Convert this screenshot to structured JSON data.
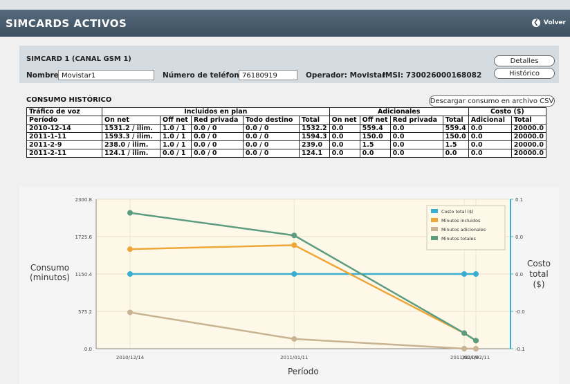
{
  "header": {
    "title": "SIMCARDS ACTIVOS",
    "back_label": "Volver"
  },
  "simcard": {
    "title": "SIMCARD 1 (CANAL GSM 1)",
    "nombre_label": "Nombre",
    "nombre_value": "Movistar1",
    "telefono_label": "Número de teléfono",
    "telefono_value": "76180919",
    "operador_label": "Operador:",
    "operador_value": "Movistar",
    "imsi_label": "IMSI:",
    "imsi_value": "730026000168082",
    "detalles_label": "Detalles",
    "historico_label": "Histórico"
  },
  "consumo": {
    "title": "CONSUMO HISTÓRICO",
    "csv_label": "Descargar consumo en archivo CSV",
    "group_headers": [
      "Tráfico de voz",
      "Incluidos en plan",
      "Adicionales",
      "Costo ($)"
    ],
    "columns": [
      "Período",
      "On net",
      "Off net",
      "Red privada",
      "Todo destino",
      "Total",
      "On net",
      "Off net",
      "Red privada",
      "Total",
      "Adicional",
      "Total"
    ],
    "rows": [
      [
        "2010-12-14",
        "1531.2 / ilim.",
        "1.0 / 1",
        "0.0 / 0",
        "0.0 / 0",
        "1532.2",
        "0.0",
        "559.4",
        "0.0",
        "559.4",
        "0.0",
        "20000.0"
      ],
      [
        "2011-1-11",
        "1593.3 / ilim.",
        "1.0 / 1",
        "0.0 / 0",
        "0.0 / 0",
        "1594.3",
        "0.0",
        "150.0",
        "0.0",
        "150.0",
        "0.0",
        "20000.0"
      ],
      [
        "2011-2-9",
        "238.0 / ilim.",
        "1.0 / 1",
        "0.0 / 0",
        "0.0 / 0",
        "239.0",
        "0.0",
        "1.5",
        "0.0",
        "1.5",
        "0.0",
        "20000.0"
      ],
      [
        "2011-2-11",
        "124.1 / ilim.",
        "0.0 / 1",
        "0.0 / 0",
        "0.0 / 0",
        "124.1",
        "0.0",
        "0.0",
        "0.0",
        "0.0",
        "0.0",
        "20000.0"
      ]
    ]
  },
  "chart_labels": {
    "y_left": "Consumo (minutos)",
    "y_right": "Costo total ($)",
    "x": "Período"
  },
  "chart_data": {
    "type": "line",
    "title": "",
    "xlabel": "Período",
    "ylabel": "Consumo (minutos)",
    "y2label": "Costo total ($)",
    "x": [
      "2010-12-14",
      "2011-01-11",
      "2011-02-09",
      "2011-02-11"
    ],
    "x_tick_labels": [
      "2010/12/14",
      "2011/01/11",
      "2011/02/09",
      "2011/02/11"
    ],
    "ylim": [
      0,
      2300.8
    ],
    "y_ticks": [
      "0.0",
      "575.2",
      "1150.4",
      "1725.6",
      "2300.8"
    ],
    "y2lim": [
      -0.1,
      0.1
    ],
    "y2_ticks": [
      "-0.1",
      "-0.0",
      "0.0",
      "0.0",
      "0.1"
    ],
    "legend_position": "top-right",
    "grid": true,
    "series": [
      {
        "name": "Costo total ($)",
        "axis": "right",
        "color": "#3aaed0",
        "values": [
          0,
          0,
          0,
          0
        ]
      },
      {
        "name": "Minutos incluidos",
        "axis": "left",
        "color": "#eea638",
        "values": [
          1532.2,
          1594.3,
          239.0,
          124.1
        ]
      },
      {
        "name": "Minutos adicionales",
        "axis": "left",
        "color": "#c8b393",
        "values": [
          559.4,
          150.0,
          1.5,
          0.0
        ]
      },
      {
        "name": "Minutos totales",
        "axis": "left",
        "color": "#5c9c80",
        "values": [
          2091.6,
          1744.3,
          240.5,
          124.1
        ]
      }
    ]
  }
}
